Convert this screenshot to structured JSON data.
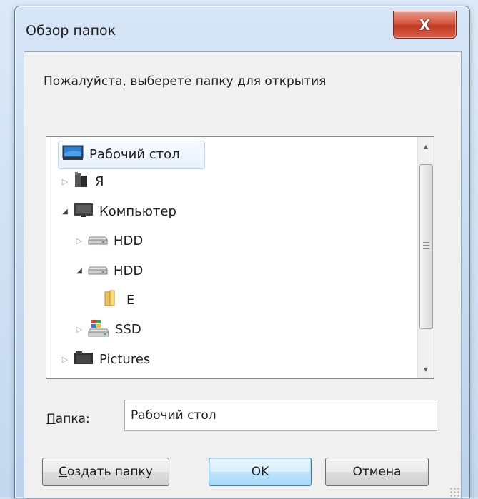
{
  "window": {
    "title": "Обзор папок",
    "close_glyph": "X"
  },
  "prompt": "Пожалуйста, выберете папку для открытия",
  "tree": {
    "items": [
      {
        "label": "Рабочий стол",
        "icon": "desktop-icon",
        "level": 0,
        "expander": "none",
        "selected": true
      },
      {
        "label": "Я",
        "icon": "user-folder-icon",
        "level": 0,
        "expander": "collapsed",
        "selected": false
      },
      {
        "label": "Компьютер",
        "icon": "computer-icon",
        "level": 0,
        "expander": "expanded",
        "selected": false
      },
      {
        "label": "HDD",
        "icon": "hard-drive-icon",
        "level": 1,
        "expander": "collapsed",
        "selected": false
      },
      {
        "label": "HDD",
        "icon": "hard-drive-icon",
        "level": 1,
        "expander": "expanded",
        "selected": false
      },
      {
        "label": "E",
        "icon": "folder-icon",
        "level": 2,
        "expander": "none",
        "selected": false
      },
      {
        "label": "SSD",
        "icon": "windows-drive-icon",
        "level": 1,
        "expander": "collapsed",
        "selected": false
      },
      {
        "label": "Pictures",
        "icon": "pictures-folder-icon",
        "level": 0,
        "expander": "collapsed",
        "selected": false
      }
    ]
  },
  "folder_field": {
    "label_accel": "П",
    "label_rest": "апка:",
    "value": "Рабочий стол"
  },
  "buttons": {
    "new_folder_accel": "С",
    "new_folder_rest": "оздать папку",
    "ok": "OK",
    "cancel": "Отмена"
  },
  "colors": {
    "selection_border": "#b8d6fb",
    "default_button_border": "#3c7fb1",
    "close_button": "#c33a23"
  }
}
